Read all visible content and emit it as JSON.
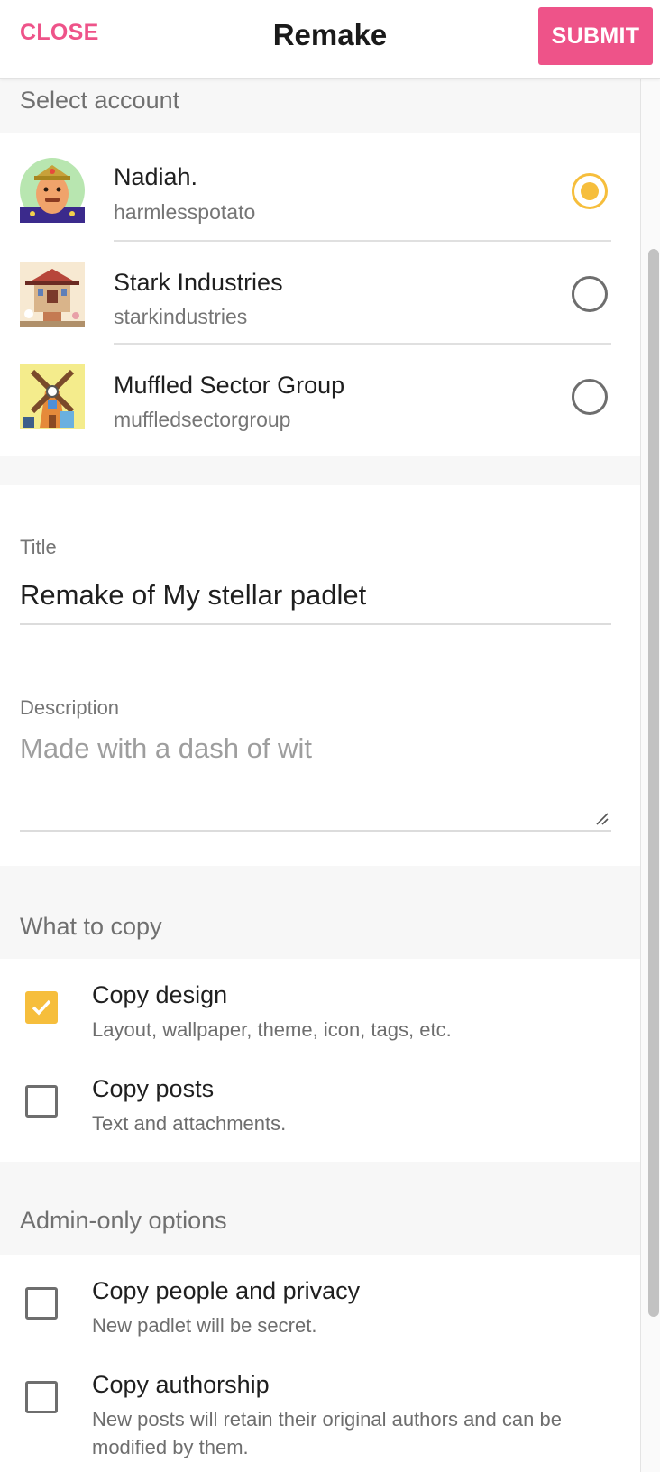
{
  "header": {
    "close_label": "CLOSE",
    "title": "Remake",
    "submit_label": "SUBMIT"
  },
  "colors": {
    "accent_pink": "#ee5389",
    "accent_yellow": "#f6be3c"
  },
  "select_account": {
    "heading": "Select account",
    "accounts": [
      {
        "name": "Nadiah.",
        "handle": "harmlesspotato",
        "selected": true,
        "avatar": "potato-character-avatar"
      },
      {
        "name": "Stark Industries",
        "handle": "starkindustries",
        "selected": false,
        "avatar": "pagoda-building-avatar"
      },
      {
        "name": "Muffled Sector Group",
        "handle": "muffledsectorgroup",
        "selected": false,
        "avatar": "windmill-avatar"
      }
    ]
  },
  "form": {
    "title_label": "Title",
    "title_value": "Remake of My stellar padlet",
    "description_label": "Description",
    "description_placeholder": "Made with a dash of wit"
  },
  "what_to_copy": {
    "heading": "What to copy",
    "options": [
      {
        "title": "Copy design",
        "description": "Layout, wallpaper, theme, icon, tags, etc.",
        "checked": true
      },
      {
        "title": "Copy posts",
        "description": "Text and attachments.",
        "checked": false
      }
    ]
  },
  "admin_options": {
    "heading": "Admin-only options",
    "options": [
      {
        "title": "Copy people and privacy",
        "description": "New padlet will be secret.",
        "checked": false
      },
      {
        "title": "Copy authorship",
        "description": "New posts will retain their original authors and can be modified by them.",
        "checked": false
      }
    ]
  }
}
